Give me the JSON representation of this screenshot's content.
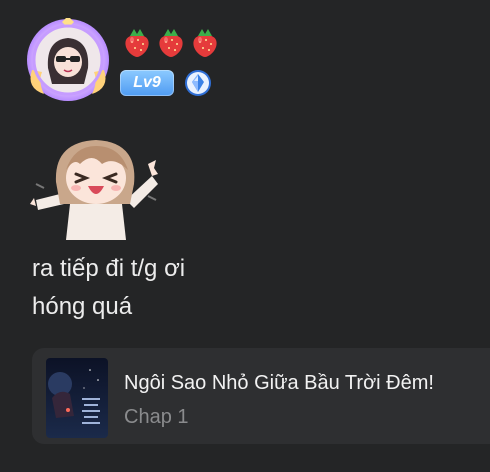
{
  "user": {
    "level_label": "Lv9",
    "badges": [
      "strawberry",
      "strawberry",
      "strawberry"
    ]
  },
  "comment": {
    "lines": [
      "ra tiếp đi t/g ơi",
      "hóng quá"
    ]
  },
  "story": {
    "title": "Ngôi Sao Nhỏ Giữa Bầu Trời Đêm!",
    "chapter": "Chap 1"
  },
  "colors": {
    "background": "#242526",
    "card": "#2e2f31",
    "level_chip": "#5aa6f5",
    "muted_text": "#8a8b8d"
  },
  "icons": [
    "avatar-frame",
    "strawberry-icon",
    "diamond-icon",
    "sticker",
    "book-cover"
  ]
}
